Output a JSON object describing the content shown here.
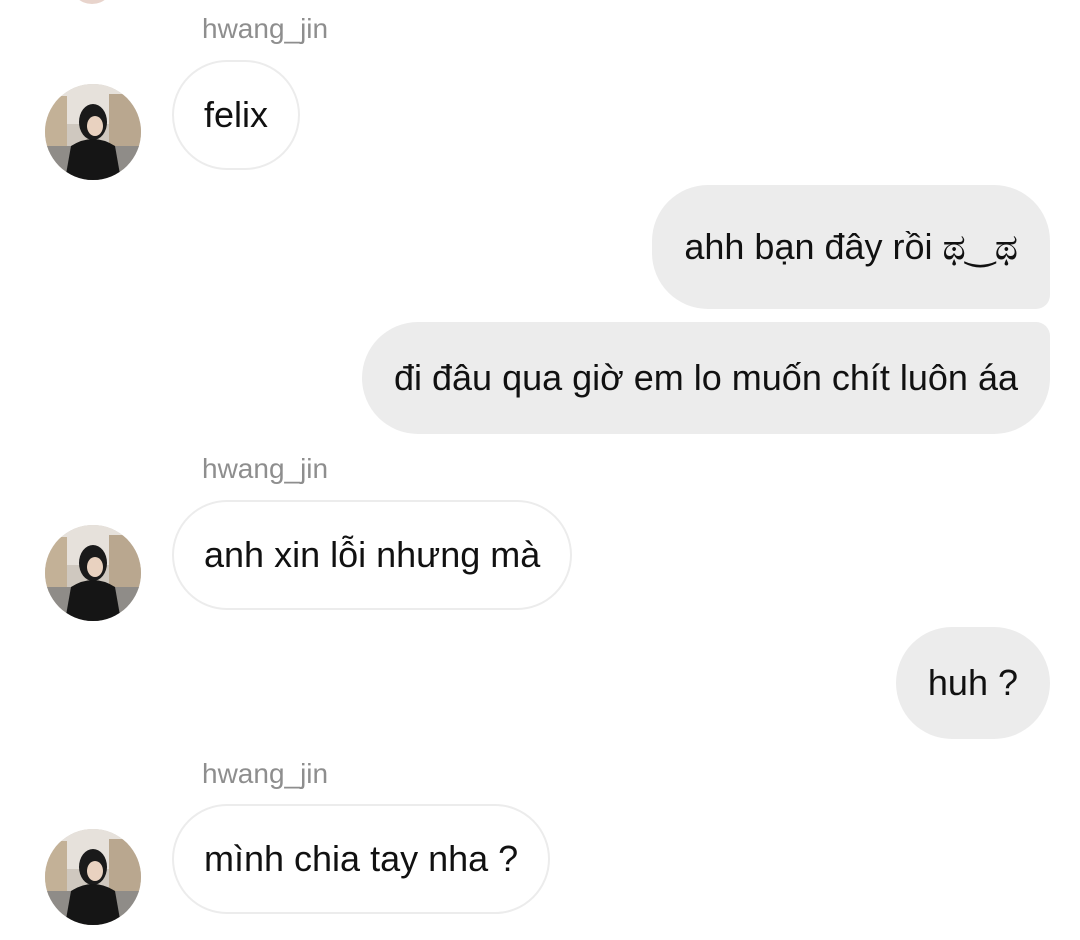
{
  "thread": {
    "groups": [
      {
        "sender": "hwang_jin",
        "messages": [
          "felix"
        ]
      },
      {
        "sender": "me",
        "messages": [
          "ahh bạn đây rồi ಥ‿ಥ",
          "đi đâu qua giờ em lo muốn chít luôn áa"
        ]
      },
      {
        "sender": "hwang_jin",
        "messages": [
          "anh xin lỗi nhưng mà"
        ]
      },
      {
        "sender": "me",
        "messages": [
          "huh ?"
        ]
      },
      {
        "sender": "hwang_jin",
        "messages": [
          "mình chia tay nha ?"
        ]
      }
    ]
  },
  "colors": {
    "incoming_bubble_bg": "#ffffff",
    "incoming_bubble_border": "#ececec",
    "outgoing_bubble_bg": "#ececec",
    "username_text": "#8e8e8e",
    "message_text": "#111111"
  },
  "icons": {
    "avatar": "profile-photo-avatar"
  }
}
